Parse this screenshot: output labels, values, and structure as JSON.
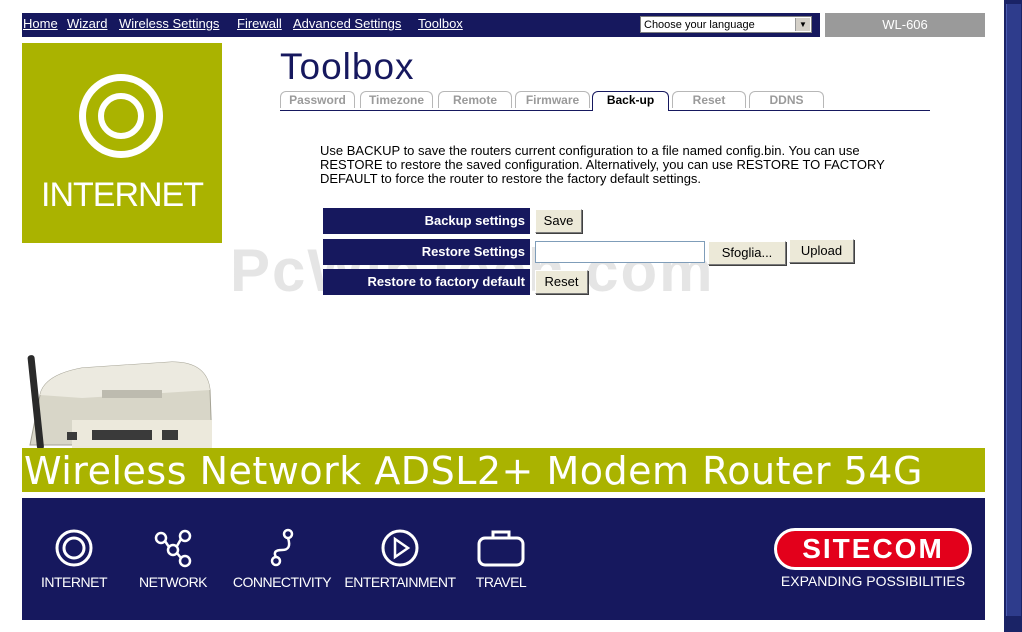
{
  "nav": {
    "links": [
      "Home",
      "Wizard",
      "Wireless Settings",
      "Firewall",
      "Advanced Settings",
      "Toolbox"
    ],
    "language_select": "Choose your language",
    "model": "WL-606"
  },
  "logo": {
    "label": "INTERNET"
  },
  "page": {
    "title": "Toolbox"
  },
  "tabs": [
    "Password",
    "Timezone",
    "Remote",
    "Firmware",
    "Back-up",
    "Reset",
    "DDNS"
  ],
  "active_tab": "Back-up",
  "description": "Use BACKUP to save the routers current configuration to a file named config.bin. You can use RESTORE to restore the saved configuration. Alternatively, you can use RESTORE TO FACTORY DEFAULT to force the router to restore the factory default settings.",
  "backup": {
    "label": "Backup settings",
    "button": "Save"
  },
  "restore": {
    "label": "Restore Settings",
    "browse_button": "Sfoglia...",
    "upload_button": "Upload"
  },
  "factory": {
    "label": "Restore to factory default",
    "button": "Reset"
  },
  "watermark": "PcWinTech.com",
  "banner": "Wireless Network ADSL2+ Modem Router 54G",
  "footer": {
    "items": [
      "INTERNET",
      "NETWORK",
      "CONNECTIVITY",
      "ENTERTAINMENT",
      "TRAVEL"
    ],
    "brand": "SITECOM",
    "tagline": "EXPANDING POSSIBILITIES",
    "icons": [
      "internet-icon",
      "network-icon",
      "connectivity-icon",
      "entertainment-icon",
      "travel-icon"
    ]
  },
  "colors": {
    "navy": "#16185e",
    "olive": "#aab300",
    "brand_red": "#e3001b",
    "gray": "#9a9a9a"
  }
}
